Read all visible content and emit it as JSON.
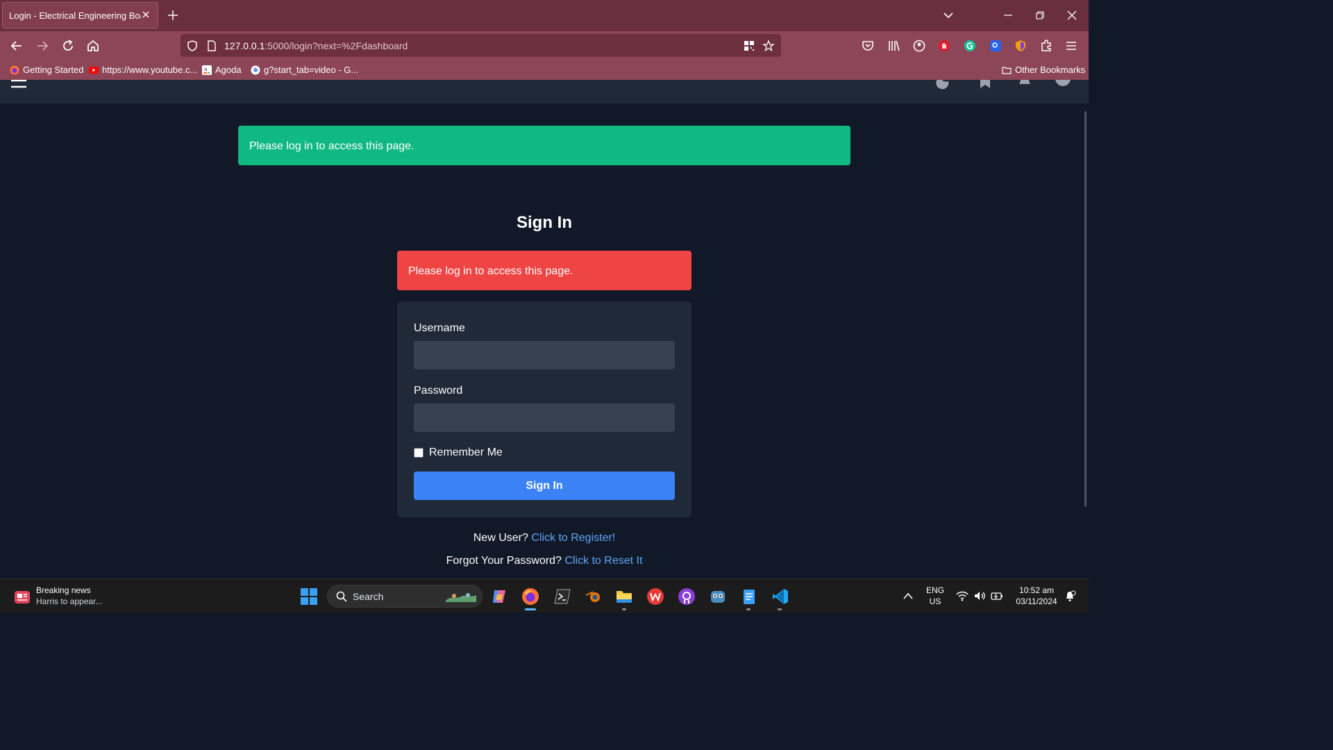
{
  "browser": {
    "tab_title": "Login - Electrical Engineering Board",
    "url_host": "127.0.0.1",
    "url_rest": ":5000/login?next=%2Fdashboard",
    "bookmarks": [
      {
        "label": "Getting Started",
        "icon": "firefox-icon"
      },
      {
        "label": "https://www.youtube.c...",
        "icon": "youtube-icon"
      },
      {
        "label": "Agoda",
        "icon": "agoda-icon"
      },
      {
        "label": "g?start_tab=video - G...",
        "icon": "google-icon"
      }
    ],
    "other_bookmarks": "Other Bookmarks",
    "accent": "#8c4657"
  },
  "page": {
    "flash_top": "Please log in to access this page.",
    "title": "Sign In",
    "flash_error": "Please log in to access this page.",
    "form": {
      "username_label": "Username",
      "username_value": "",
      "password_label": "Password",
      "password_value": "",
      "remember_label": "Remember Me",
      "remember_checked": false,
      "submit_label": "Sign In"
    },
    "register_prompt": "New User?",
    "register_link": "Click to Register!",
    "reset_prompt": "Forgot Your Password?",
    "reset_link": "Click to Reset It",
    "colors": {
      "success": "#10b981",
      "error": "#ef4444",
      "primary": "#3b82f6",
      "link": "#60a5fa"
    }
  },
  "taskbar": {
    "news_title": "Breaking news",
    "news_sub": "Harris to appear...",
    "search_label": "Search",
    "lang": "ENG",
    "region": "US",
    "time": "10:52 am",
    "date": "03/11/2024"
  }
}
